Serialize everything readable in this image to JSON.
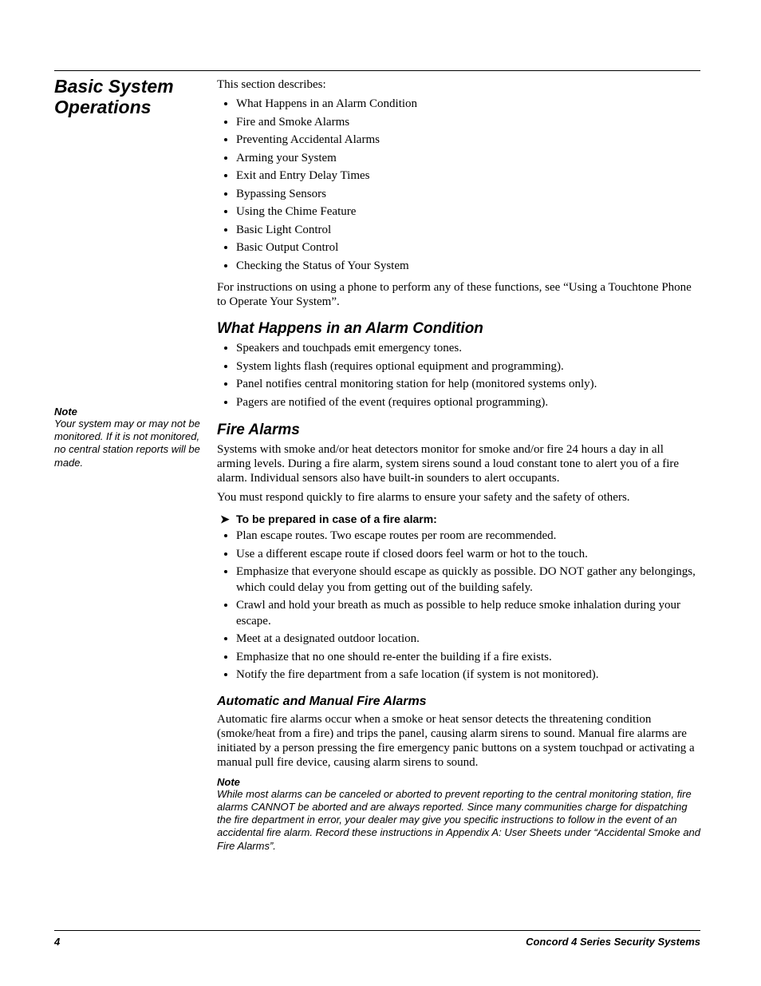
{
  "section_title": "Basic System Operations",
  "intro_line": "This section describes:",
  "intro_bullets": [
    "What Happens in an Alarm Condition",
    "Fire and Smoke Alarms",
    "Preventing Accidental Alarms",
    "Arming your System",
    "Exit and Entry Delay Times",
    "Bypassing Sensors",
    "Using the Chime Feature",
    "Basic Light Control",
    "Basic Output Control",
    "Checking the Status of Your System"
  ],
  "intro_after": "For instructions on using a phone to perform any of these functions, see “Using a Touchtone Phone to Operate Your System”.",
  "side_note": {
    "label": "Note",
    "body": "Your system may or may not be monitored. If it is not monitored, no central station reports will be made."
  },
  "sub1": {
    "title": "What Happens in an Alarm Condition",
    "bullets": [
      "Speakers and touchpads emit emergency tones.",
      "System lights flash (requires optional equipment and programming).",
      "Panel notifies central monitoring station for help (monitored systems only).",
      "Pagers are notified of the event (requires optional programming)."
    ]
  },
  "sub2": {
    "title": "Fire Alarms",
    "para1": "Systems with smoke and/or heat detectors monitor for smoke and/or fire 24 hours a day in all arming levels. During a fire alarm, system sirens sound a loud constant tone to alert you of a fire alarm. Individual sensors also have built-in sounders to alert occupants.",
    "para2": "You must respond quickly to fire alarms to ensure your safety and the safety of others.",
    "checklist_lead": "To be prepared in case of a fire alarm:",
    "checklist": [
      "Plan escape routes. Two escape routes per room are recommended.",
      "Use a different escape route if closed doors feel warm or hot to the touch.",
      "Emphasize that everyone should escape as quickly as possible. DO NOT gather any belongings, which could delay you from getting out of the building safely.",
      "Crawl and hold your breath as much as possible to help reduce smoke inhalation during your escape.",
      "Meet at a designated outdoor location.",
      "Emphasize that no one should re-enter the building if a fire exists.",
      "Notify the fire department from a safe location (if system is not monitored)."
    ]
  },
  "sub3": {
    "title": "Automatic and Manual Fire Alarms",
    "para": "Automatic fire alarms occur when a smoke or heat sensor detects the threatening condition (smoke/heat from a fire) and trips the panel, causing alarm sirens to sound. Manual fire alarms are initiated by a person pressing the fire emergency panic buttons on a system touchpad or activating a manual pull fire device, causing alarm sirens to sound.",
    "note_label": "Note",
    "note_body": "While most alarms can be canceled or aborted to prevent reporting to the central monitoring station, fire alarms CANNOT be aborted and are always reported. Since many communities charge for dispatching the fire department in error, your dealer may give you specific instructions to follow in the event of an accidental fire alarm. Record these instructions in Appendix A: User Sheets under “Accidental Smoke and Fire Alarms”."
  },
  "footer": {
    "page_number": "4",
    "product": "Concord  4 Series Security Systems"
  }
}
